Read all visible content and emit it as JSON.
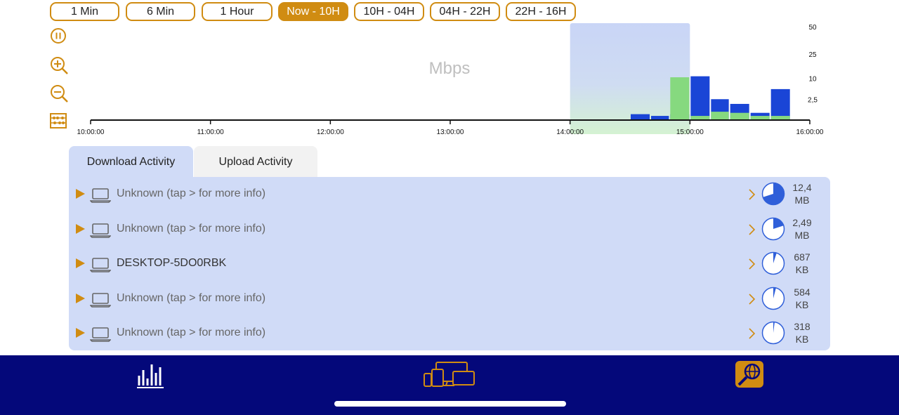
{
  "ranges": [
    {
      "label": "1 Min",
      "active": false
    },
    {
      "label": "6 Min",
      "active": false
    },
    {
      "label": "1 Hour",
      "active": false
    },
    {
      "label": "Now - 10H",
      "active": true
    },
    {
      "label": "10H - 04H",
      "active": false
    },
    {
      "label": "04H - 22H",
      "active": false
    },
    {
      "label": "22H - 16H",
      "active": false
    }
  ],
  "tools": {
    "pause": "pause-icon",
    "zoom_in": "zoom-in-icon",
    "zoom_out": "zoom-out-icon",
    "abacus": "abacus-icon"
  },
  "chart_data": {
    "type": "bar",
    "unit_label": "Mbps",
    "x_ticks": [
      "10:00:00",
      "11:00:00",
      "12:00:00",
      "13:00:00",
      "14:00:00",
      "15:00:00",
      "16:00:00"
    ],
    "y_ticks": [
      "50",
      "25",
      "10",
      "2,5"
    ],
    "y_tick_values": [
      50,
      25,
      10,
      2.5
    ],
    "y_scale": "sqrt",
    "xlim_hours": [
      10,
      16
    ],
    "highlight_range_hours": [
      14,
      15
    ],
    "series": [
      {
        "color": "#1a45d6",
        "bars": [
          {
            "start": 14.5,
            "end": 14.67,
            "value": 0.2
          },
          {
            "start": 14.67,
            "end": 14.83,
            "value": 0.1
          },
          {
            "start": 14.83,
            "end": 15.0,
            "value": 0.2
          },
          {
            "start": 15.0,
            "end": 15.17,
            "value": 11
          },
          {
            "start": 15.17,
            "end": 15.33,
            "value": 2.5
          },
          {
            "start": 15.33,
            "end": 15.5,
            "value": 1.5
          },
          {
            "start": 15.5,
            "end": 15.67,
            "value": 0.3
          },
          {
            "start": 15.67,
            "end": 15.84,
            "value": 5.5
          }
        ]
      },
      {
        "color": "#86d97f",
        "bars": [
          {
            "start": 14.5,
            "end": 14.67,
            "value": 0.0
          },
          {
            "start": 14.83,
            "end": 15.0,
            "value": 10.5
          },
          {
            "start": 15.0,
            "end": 15.17,
            "value": 0.1
          },
          {
            "start": 15.17,
            "end": 15.33,
            "value": 0.4
          },
          {
            "start": 15.33,
            "end": 15.5,
            "value": 0.3
          },
          {
            "start": 15.5,
            "end": 15.67,
            "value": 0.1
          },
          {
            "start": 15.67,
            "end": 15.84,
            "value": 0.1
          }
        ]
      }
    ]
  },
  "tabs": {
    "download": "Download Activity",
    "upload": "Upload Activity"
  },
  "devices": [
    {
      "name": "Unknown (tap > for more info)",
      "size_value": "12,4",
      "size_unit": "MB",
      "share": 0.7,
      "dark": false
    },
    {
      "name": "Unknown (tap > for more info)",
      "size_value": "2,49",
      "size_unit": "MB",
      "share": 0.2,
      "dark": false
    },
    {
      "name": "DESKTOP-5DO0RBK",
      "size_value": "687",
      "size_unit": "KB",
      "share": 0.05,
      "dark": true
    },
    {
      "name": "Unknown (tap > for more info)",
      "size_value": "584",
      "size_unit": "KB",
      "share": 0.04,
      "dark": false
    },
    {
      "name": "Unknown (tap > for more info)",
      "size_value": "318",
      "size_unit": "KB",
      "share": 0.02,
      "dark": false
    }
  ],
  "colors": {
    "accent": "#d08c12",
    "panel": "#d0dbf7",
    "pie": "#2f5fd9",
    "navbar": "#04087a"
  },
  "nav": {
    "stats": "bar-chart-icon",
    "devices": "devices-icon",
    "network": "network-scan-icon"
  }
}
